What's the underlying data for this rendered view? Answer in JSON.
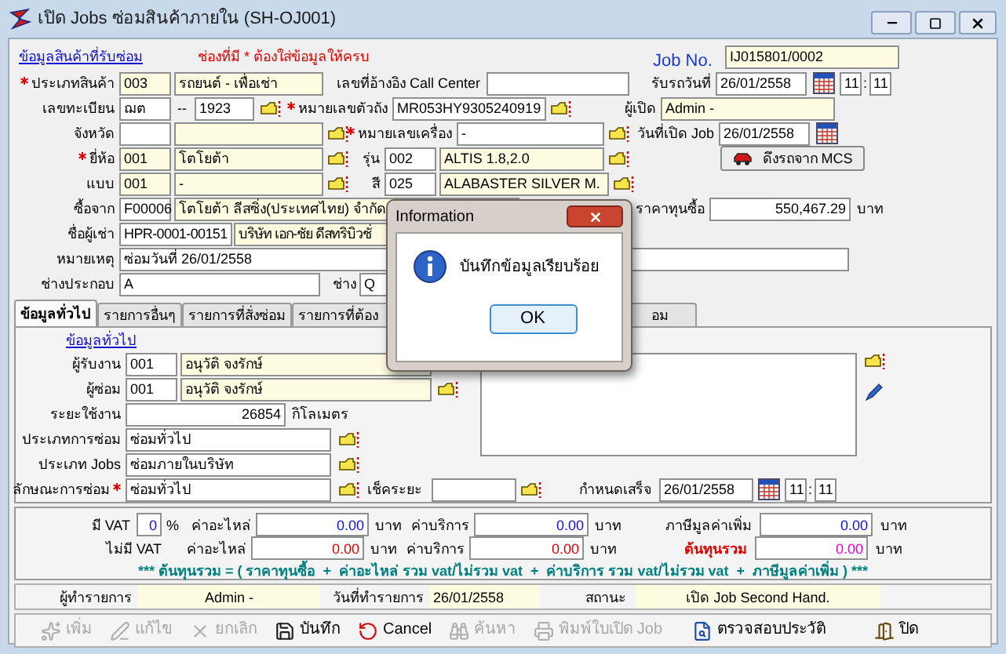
{
  "window": {
    "title": "เปิด Jobs ซ่อมสินค้าภายใน (SH-OJ001)"
  },
  "product": {
    "link": "ข้อมูลสินค้าที่รับซ่อม",
    "note": "ช่องที่มี * ต้องใส่ข้อมูลให้ครบ",
    "job_no": {
      "label": "Job No.",
      "value": "IJ015801/0002"
    },
    "product_type": {
      "label": "ประเภทสินค้า",
      "required": true,
      "code": "003",
      "name": "รถยนต์ - เพื่อเช่า"
    },
    "call_center": {
      "label": "เลขที่อ้างอิง Call Center"
    },
    "receive_date": {
      "label": "รับรถวันที่",
      "date": "26/01/2558",
      "hour": "11",
      "separator": ":",
      "minute": "11"
    },
    "plate": {
      "label": "เลขทะเบียน",
      "prefix": "ฌต",
      "separator": "--",
      "number": "1923"
    },
    "chassis": {
      "label": "หมายเลขตัวถัง",
      "required": true,
      "value": "MR053HY9305240919"
    },
    "opened_by": {
      "label": "ผู้เปิด",
      "value": "Admin -"
    },
    "province": {
      "label": "จังหวัด"
    },
    "engine": {
      "label": "หมายเลขเครื่อง",
      "required": true,
      "value": "-"
    },
    "open_date": {
      "label": "วันที่เปิด Job",
      "date": "26/01/2558"
    },
    "brand": {
      "label": "ยี่ห้อ",
      "required": true,
      "code": "001",
      "name": "โตโยต้า"
    },
    "model": {
      "label": "รุ่น",
      "code": "002",
      "name": "ALTIS 1.8,2.0"
    },
    "mcs_button": {
      "label": "ดึงรถจาก MCS"
    },
    "style": {
      "label": "แบบ",
      "code": "001",
      "name": "-"
    },
    "paint": {
      "label": "สี",
      "code": "025",
      "name": "ALABASTER SILVER M."
    },
    "bought_from": {
      "label": "ซื้อจาก",
      "code": "F00006",
      "name": "โตโยต้า ลีสซิ่ง(ประเทศไทย) จำกัด"
    },
    "cost_price": {
      "label": "ราคาทุนซื้อ",
      "value": "550,467.29",
      "unit": "บาท"
    },
    "lessee": {
      "label": "ชื่อผู้เช่า",
      "code": "HPR-0001-00151",
      "name": "บริษัท เอก-ชัย ดีสทริบิวชั่"
    },
    "remark": {
      "label": "หมายเหตุ",
      "value": "ซ่อมวันที่ 26/01/2558"
    },
    "assembler": {
      "label": "ช่างประกอบ",
      "value": "A"
    },
    "technician": {
      "label": "ช่าง",
      "value": "Q"
    }
  },
  "tabs": [
    {
      "label": "ข้อมูลทั่วไป",
      "selected": true
    },
    {
      "label": "รายการอื่นๆ",
      "selected": false
    },
    {
      "label": "รายการที่สั่งซ่อม",
      "selected": false
    },
    {
      "label": "รายการที่ต้อง",
      "selected": false
    },
    {
      "label": "อม",
      "selected": false
    }
  ],
  "general": {
    "link": "ข้อมูลทั่วไป",
    "receiver": {
      "label": "ผู้รับงาน",
      "code": "001",
      "name": "อนุวัติ จงรักษ์"
    },
    "repairer": {
      "label": "ผู้ซ่อม",
      "code": "001",
      "name": "อนุวัติ จงรักษ์"
    },
    "mileage": {
      "label": "ระยะใช้งาน",
      "value": "26854",
      "unit": "กิโลเมตร"
    },
    "repair_type": {
      "label": "ประเภทการซ่อม",
      "value": "ซ่อมทั่วไป"
    },
    "job_type": {
      "label": "ประเภท Jobs",
      "value": "ซ่อมภายในบริษัท"
    },
    "repair_nature": {
      "label": "ลักษณะการซ่อม",
      "required": true,
      "value": "ซ่อมทั่วไป"
    },
    "check_distance": {
      "label": "เช็คระยะ"
    },
    "due": {
      "label": "กำหนดเสร็จ",
      "date": "26/01/2558",
      "hour": "11",
      "separator": ":",
      "minute": "11"
    }
  },
  "costs": {
    "with_vat": {
      "label": "มี VAT",
      "rate": "0",
      "rate_unit": "%",
      "parts_label": "ค่าอะไหล่",
      "parts": "0.00",
      "parts_unit": "บาท",
      "service_label": "ค่าบริการ",
      "service": "0.00",
      "service_unit": "บาท",
      "tax_label": "ภาษีมูลค่าเพิ่ม",
      "tax": "0.00",
      "tax_unit": "บาท"
    },
    "without_vat": {
      "label": "ไม่มี VAT",
      "parts_label": "ค่าอะไหล่",
      "parts": "0.00",
      "parts_unit": "บาท",
      "service_label": "ค่าบริการ",
      "service": "0.00",
      "service_unit": "บาท",
      "total_label": "ต้นทุนรวม",
      "total": "0.00",
      "total_unit": "บาท"
    },
    "formula": "*** ต้นทุนรวม = ( ราคาทุนซื้อ  +  ค่าอะไหล่ รวม vat/ไม่รวม vat  +  ค่าบริการ รวม vat/ไม่รวม vat  +  ภาษีมูลค่าเพิ่ม ) ***"
  },
  "status_bar": {
    "operator_label": "ผู้ทำรายการ",
    "operator": "Admin -",
    "date_label": "วันที่ทำรายการ",
    "date": "26/01/2558",
    "status_label": "สถานะ",
    "status": "เปิด  Job Second Hand."
  },
  "toolbar": [
    {
      "kind": "add",
      "label": "เพิ่ม",
      "disabled": true
    },
    {
      "kind": "edit",
      "label": "แก้ไข",
      "disabled": true
    },
    {
      "kind": "void",
      "label": "ยกเลิก",
      "disabled": true
    },
    {
      "kind": "save",
      "label": "บันทึก",
      "disabled": false
    },
    {
      "kind": "cancel",
      "label": "Cancel",
      "disabled": false
    },
    {
      "kind": "search",
      "label": "ค้นหา",
      "disabled": true
    },
    {
      "kind": "print",
      "label": "พิมพ์ใบเปิด Job",
      "disabled": true
    },
    {
      "kind": "history",
      "label": "ตรวจสอบประวัติ",
      "disabled": false
    },
    {
      "kind": "close",
      "label": "ปิด",
      "disabled": false
    }
  ],
  "dialog": {
    "title": "Information",
    "message": "บันทึกข้อมูลเรียบร้อย",
    "button": "OK"
  }
}
